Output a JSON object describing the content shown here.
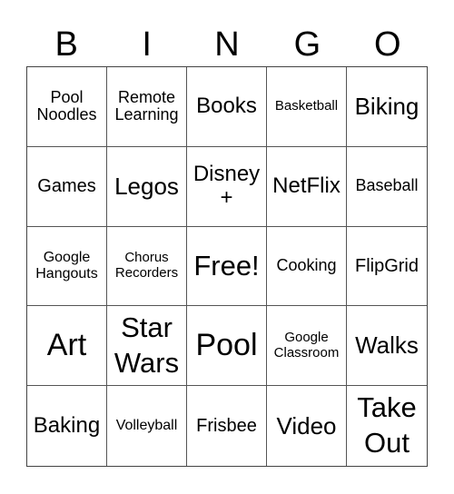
{
  "header": [
    "B",
    "I",
    "N",
    "G",
    "O"
  ],
  "cells": [
    [
      "Pool Noodles",
      "Remote Learning",
      "Books",
      "Basketball",
      "Biking"
    ],
    [
      "Games",
      "Legos",
      "Disney +",
      "NetFlix",
      "Baseball"
    ],
    [
      "Google Hangouts",
      "Chorus Recorders",
      "Free!",
      "Cooking",
      "FlipGrid"
    ],
    [
      "Art",
      "Star Wars",
      "Pool",
      "Google Classroom",
      "Walks"
    ],
    [
      "Baking",
      "Volleyball",
      "Frisbee",
      "Video",
      "Take Out"
    ]
  ]
}
